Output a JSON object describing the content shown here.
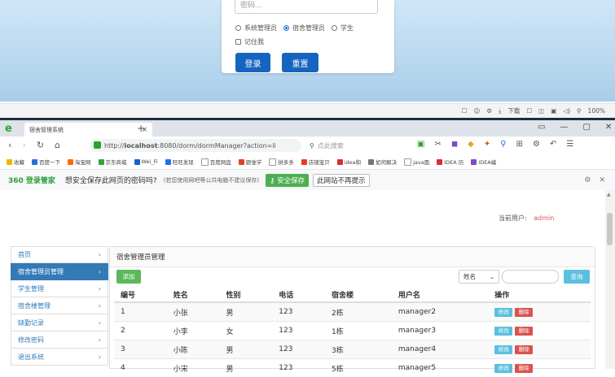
{
  "login": {
    "password_placeholder": "密码...",
    "roles": [
      "系统管理员",
      "宿舍管理员",
      "学生"
    ],
    "selected_role": "宿舍管理员",
    "remember_label": "记住我",
    "login_label": "登录",
    "reset_label": "重置"
  },
  "tray": {
    "download": "下载",
    "zoom": "100%"
  },
  "browser": {
    "tab_title": "宿舍管理系统",
    "new_tab": "+",
    "url_prefix": "http://",
    "url_host": "localhost",
    "url_rest": ":8080/dorm/dormManager?action=li",
    "search_placeholder": "点此搜索",
    "bookmarks": [
      "收藏",
      "百度一下",
      "淘宝网",
      "京东商城",
      "Wei_Fi",
      "旺旺发现",
      "百度网盘",
      "跟谁学",
      "拼多多",
      "店铺宝贝",
      "idea和",
      "如何解决",
      "java面",
      "IDEA 历",
      "IDEA编"
    ]
  },
  "pw_bar": {
    "brand": "360 登录管家",
    "question": "想安全保存此网页的密码吗?",
    "hint": "(若您使用网吧等公共电脑不建议保存)",
    "save_label": "安全保存",
    "no_prompt_label": "此网站不再提示"
  },
  "page": {
    "user_prefix": "当前用户:",
    "user_name": "admin",
    "sidebar": [
      {
        "label": "首页",
        "active": false
      },
      {
        "label": "宿舍管理员管理",
        "active": true
      },
      {
        "label": "学生管理",
        "active": false
      },
      {
        "label": "宿舍楼管理",
        "active": false
      },
      {
        "label": "缺勤记录",
        "active": false
      },
      {
        "label": "修改密码",
        "active": false
      },
      {
        "label": "退出系统",
        "active": false
      }
    ],
    "panel_title": "宿舍管理员管理",
    "add_label": "添加",
    "select_value": "姓名",
    "query_label": "查询",
    "columns": [
      "编号",
      "姓名",
      "性别",
      "电话",
      "宿舍楼",
      "用户名",
      "操作"
    ],
    "rows": [
      [
        "1",
        "小张",
        "男",
        "123",
        "2栋",
        "manager2"
      ],
      [
        "2",
        "小李",
        "女",
        "123",
        "1栋",
        "manager3"
      ],
      [
        "3",
        "小陈",
        "男",
        "123",
        "3栋",
        "manager4"
      ],
      [
        "4",
        "小宋",
        "男",
        "123",
        "5栋",
        "manager5"
      ]
    ],
    "edit_label": "修改",
    "delete_label": "删除"
  }
}
